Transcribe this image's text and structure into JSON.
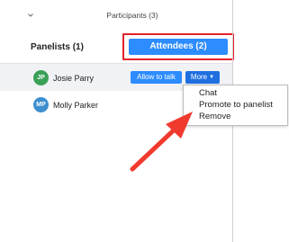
{
  "header": {
    "chevron_icon": "chevron-down-icon",
    "title": "Participants (3)"
  },
  "tabs": {
    "panelists_label": "Panelists (1)",
    "attendees_label": "Attendees (2)"
  },
  "participants": [
    {
      "initials": "JP",
      "name": "Josie Parry",
      "avatar_color": "#3aa157",
      "allow_label": "Allow to talk",
      "more_label": "More"
    },
    {
      "initials": "MP",
      "name": "Molly Parker",
      "avatar_color": "#3d8fd0"
    }
  ],
  "more_menu": {
    "items": [
      "Chat",
      "Promote to panelist",
      "Remove"
    ]
  },
  "colors": {
    "accent": "#2d8cff",
    "highlight": "#e5222b"
  }
}
